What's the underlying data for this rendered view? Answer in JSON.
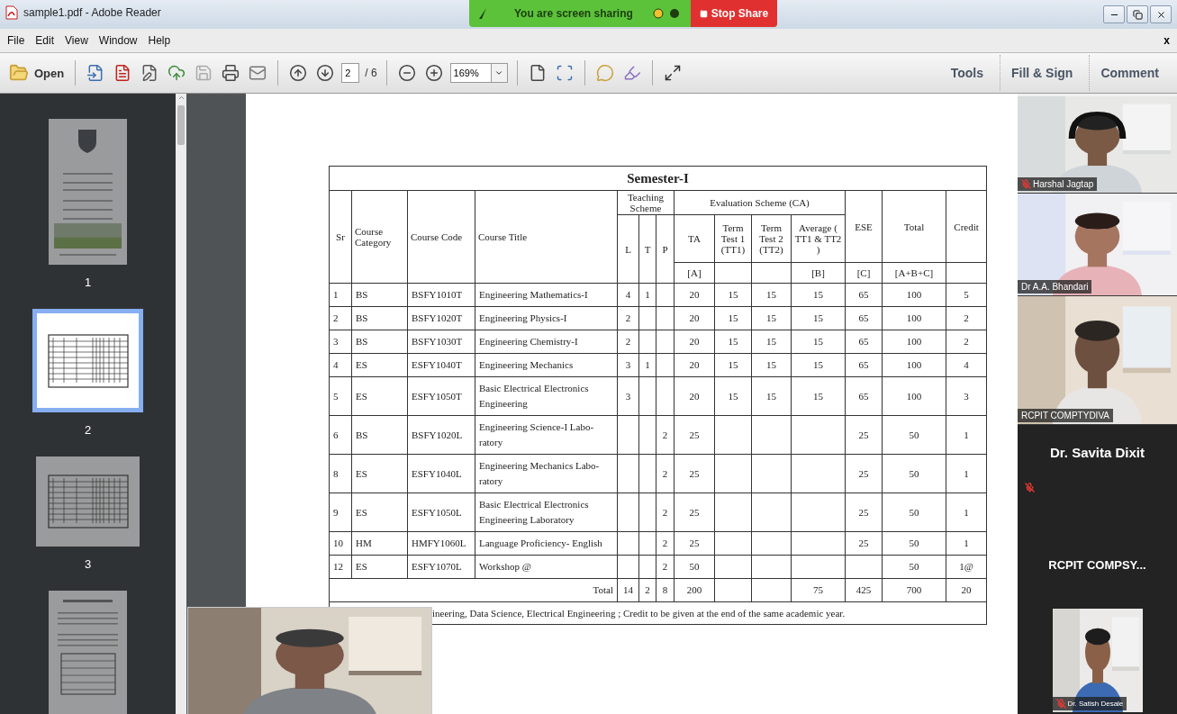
{
  "window": {
    "title": "sample1.pdf - Adobe Reader"
  },
  "screen_share": {
    "status": "You are screen sharing",
    "stop_label": "Stop Share"
  },
  "menu": [
    "File",
    "Edit",
    "View",
    "Window",
    "Help"
  ],
  "menu_close": "x",
  "toolbar": {
    "open_label": "Open",
    "page_value": "2",
    "page_total": "/ 6",
    "zoom_value": "169%",
    "panels": [
      "Tools",
      "Fill & Sign",
      "Comment"
    ]
  },
  "pages": [
    {
      "label": "1",
      "kind": "cover",
      "selected": false
    },
    {
      "label": "2",
      "kind": "table",
      "selected": true
    },
    {
      "label": "3",
      "kind": "table",
      "selected": false
    },
    {
      "kind": "text",
      "selected": false
    }
  ],
  "table": {
    "title": "Semester-I",
    "head": {
      "sr": "Sr",
      "category": "Course Category",
      "code": "Course Code",
      "course_title": "Course Title",
      "teaching": "Teaching Scheme",
      "teaching_cols": [
        "L",
        "T",
        "P"
      ],
      "evaluation": "Evaluation Scheme (CA)",
      "eval_cols": [
        "TA",
        "Term Test 1 (TT1)",
        "Term Test 2 (TT2)",
        "Average ( TT1 & TT2 )"
      ],
      "ese": "ESE",
      "total": "Total",
      "credit": "Credit",
      "marks": {
        "ta": "[A]",
        "avg": "[B]",
        "ese": "[C]",
        "total": "[A+B+C]"
      }
    },
    "rows": [
      {
        "sr": "1",
        "category": "BS",
        "code": "BSFY1010T",
        "title": "Engineering Mathematics-I",
        "l": "4",
        "t": "1",
        "ta": "20",
        "tt1": "15",
        "tt2": "15",
        "avg": "15",
        "ese": "65",
        "total": "100",
        "credit": "5"
      },
      {
        "sr": "2",
        "category": "BS",
        "code": "BSFY1020T",
        "title": "Engineering Physics-I",
        "l": "2",
        "ta": "20",
        "tt1": "15",
        "tt2": "15",
        "avg": "15",
        "ese": "65",
        "total": "100",
        "credit": "2"
      },
      {
        "sr": "3",
        "category": "BS",
        "code": "BSFY1030T",
        "title": "Engineering Chemistry-I",
        "l": "2",
        "ta": "20",
        "tt1": "15",
        "tt2": "15",
        "avg": "15",
        "ese": "65",
        "total": "100",
        "credit": "2"
      },
      {
        "sr": "4",
        "category": "ES",
        "code": "ESFY1040T",
        "title": "Engineering Mechanics",
        "l": "3",
        "t": "1",
        "ta": "20",
        "tt1": "15",
        "tt2": "15",
        "avg": "15",
        "ese": "65",
        "total": "100",
        "credit": "4"
      },
      {
        "sr": "5",
        "category": "ES",
        "code": "ESFY1050T",
        "title": "Basic Electrical Electronics Engineering",
        "l": "3",
        "ta": "20",
        "tt1": "15",
        "tt2": "15",
        "avg": "15",
        "ese": "65",
        "total": "100",
        "credit": "3"
      },
      {
        "sr": "6",
        "category": "BS",
        "code": "BSFY1020L",
        "title": "Engineering Science-I Labo-\nratory",
        "p": "2",
        "ta": "25",
        "ese": "25",
        "total": "50",
        "credit": "1"
      },
      {
        "sr": "8",
        "category": "ES",
        "code": "ESFY1040L",
        "title": "Engineering Mechanics Labo-\nratory",
        "p": "2",
        "ta": "25",
        "ese": "25",
        "total": "50",
        "credit": "1"
      },
      {
        "sr": "9",
        "category": "ES",
        "code": "ESFY1050L",
        "title": "Basic Electrical Electronics Engineering Laboratory",
        "p": "2",
        "ta": "25",
        "ese": "25",
        "total": "50",
        "credit": "1"
      },
      {
        "sr": "10",
        "category": "HM",
        "code": "HMFY1060L",
        "title": "Language Proficiency- English",
        "p": "2",
        "ta": "25",
        "ese": "25",
        "total": "50",
        "credit": "1"
      },
      {
        "sr": "12",
        "category": "ES",
        "code": "ESFY1070L",
        "title": "Workshop @",
        "p": "2",
        "ta": "50",
        "total": "50",
        "credit": "1@"
      }
    ],
    "total_row": {
      "label": "Total",
      "l": "14",
      "t": "2",
      "p": "8",
      "ta": "200",
      "avg": "75",
      "ese": "425",
      "total": "700",
      "credit": "20"
    },
    "footnote": "ineering, Data Science, Electrical Engineering ; Credit to be given at the end of the same academic year."
  },
  "presenter_video": {
    "kind": "picture"
  },
  "participants": [
    {
      "kind": "video",
      "name": "Harshal Jagtap",
      "muted": true
    },
    {
      "kind": "video",
      "name": "Dr A.A. Bhandari",
      "muted": false
    },
    {
      "kind": "video",
      "name": "RCPIT COMPTYDIVA",
      "muted": false
    },
    {
      "kind": "name",
      "name": "Dr. Savita Dixit",
      "muted": true
    },
    {
      "kind": "name",
      "name": "RCPIT  COMPSY...",
      "muted": false
    },
    {
      "kind": "small_video",
      "name": "Dr. Satish Desale",
      "muted": true
    }
  ]
}
